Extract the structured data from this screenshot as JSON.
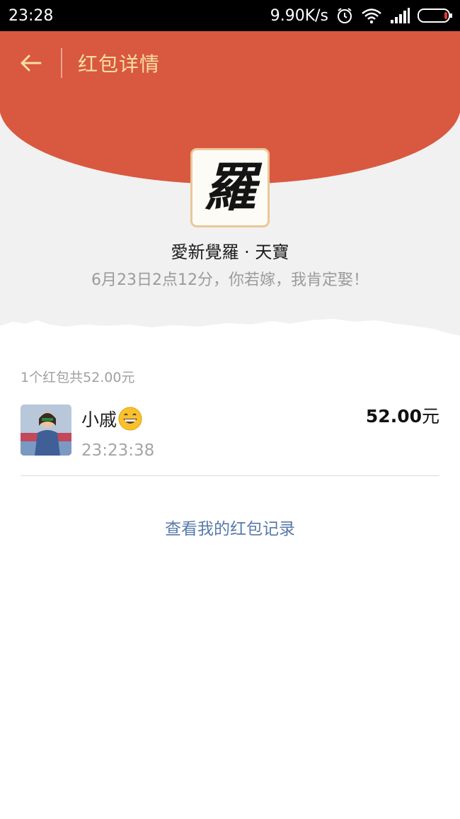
{
  "status_bar": {
    "time": "23:28",
    "network_speed": "9.90K/s",
    "icons": [
      "alarm-icon",
      "wifi-icon",
      "signal-icon",
      "battery-icon"
    ]
  },
  "nav": {
    "back_icon": "back-arrow-icon",
    "title": "红包详情"
  },
  "sender": {
    "avatar_glyph": "羅",
    "name": "愛新覺羅 · 天寶",
    "wish": "6月23日2点12分，你若嫁，我肯定娶！"
  },
  "summary": "1个红包共52.00元",
  "records": [
    {
      "name": "小戚",
      "emoji": "grinning-face-emoji",
      "time": "23:23:38",
      "amount": "52.00",
      "amount_unit": "元"
    }
  ],
  "history_link": "查看我的红包记录",
  "colors": {
    "header_red": "#d95840",
    "title_gold": "#f6dfa0",
    "link_blue": "#587aa7",
    "avatar_border": "#e9c799"
  }
}
